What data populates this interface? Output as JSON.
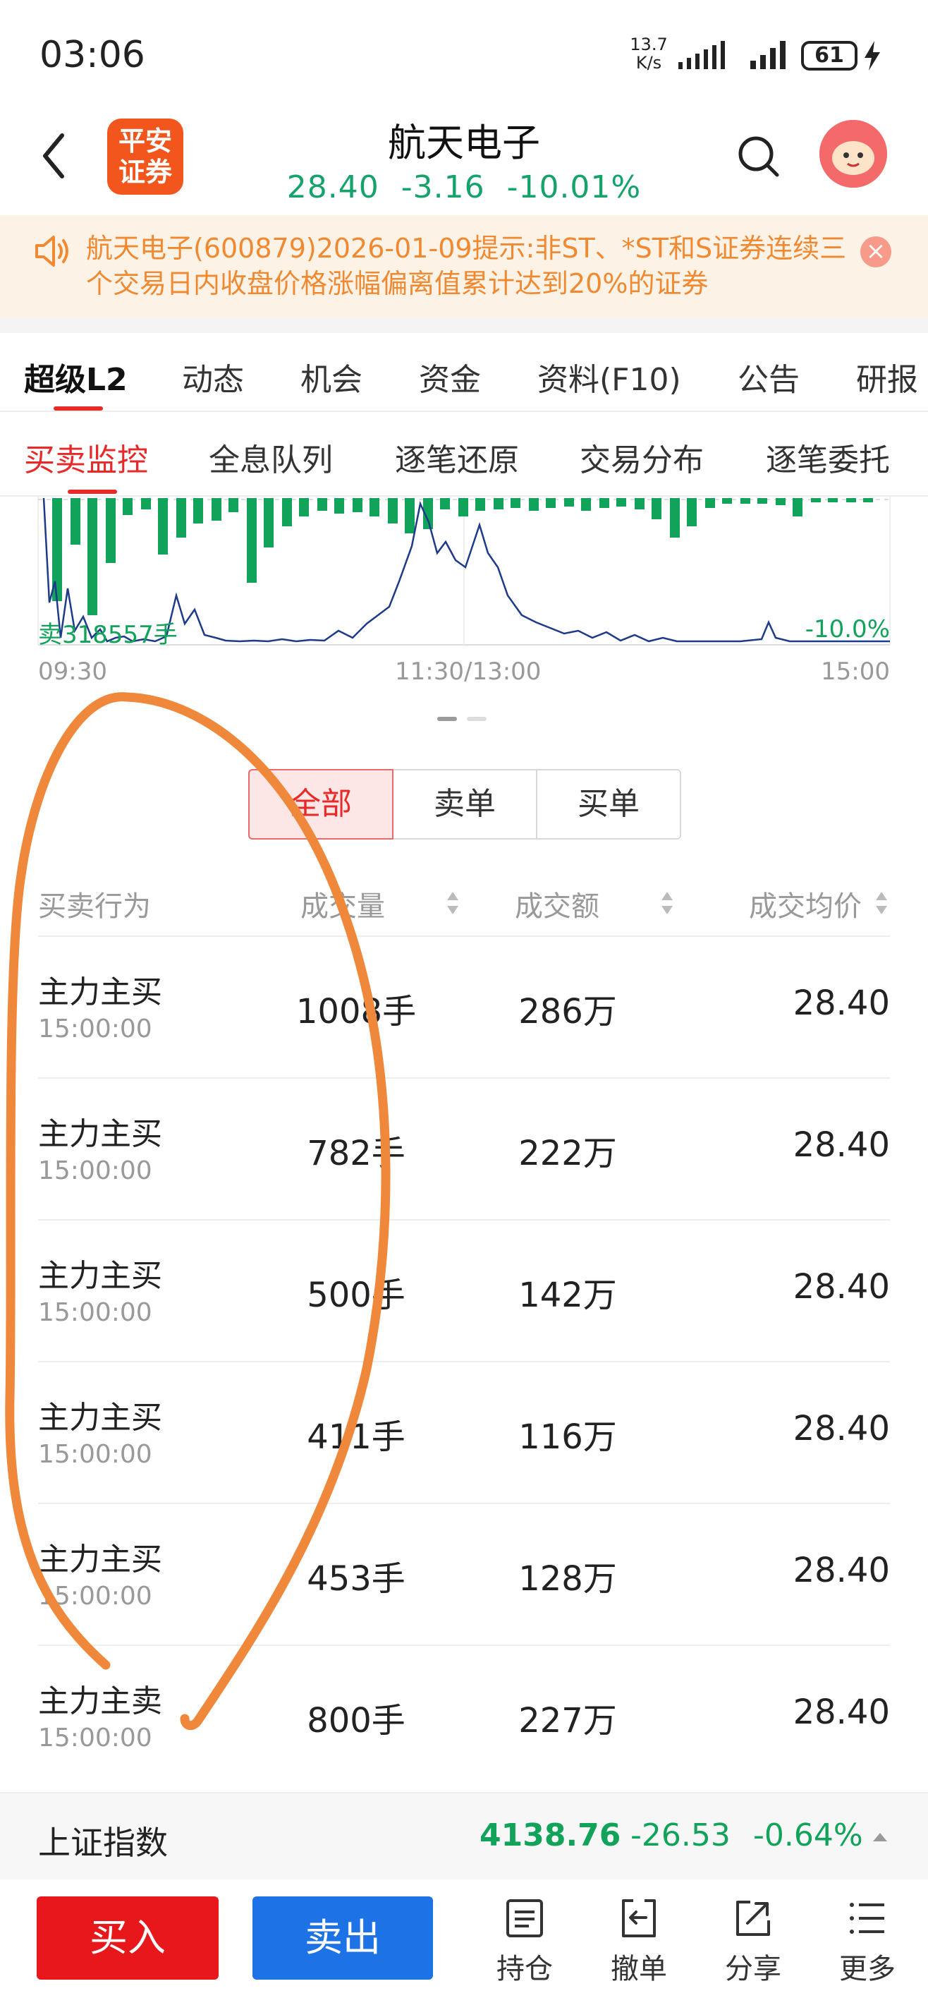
{
  "status_bar": {
    "time": "03:06",
    "net_speed_value": "13.7",
    "net_speed_unit": "K/s",
    "battery": "61"
  },
  "header": {
    "logo_line1": "平安",
    "logo_line2": "证券",
    "stock_name": "航天电子",
    "price": "28.40",
    "change": "-3.16",
    "change_pct": "-10.01%"
  },
  "notice": {
    "text": "航天电子(600879)2026-01-09提示:非ST、*ST和S证券连续三个交易日内收盘价格涨幅偏离值累计达到20%的证券"
  },
  "tabs_main": [
    "超级L2",
    "动态",
    "机会",
    "资金",
    "资料(F10)",
    "公告",
    "研报"
  ],
  "tabs_sub": [
    "买卖监控",
    "全息队列",
    "逐笔还原",
    "交易分布",
    "逐笔委托"
  ],
  "chart": {
    "sell_label": "卖318557手",
    "pct_label": "-10.0%",
    "time_start": "09:30",
    "time_mid": "11:30/13:00",
    "time_end": "15:00"
  },
  "filter": {
    "all": "全部",
    "sell": "卖单",
    "buy": "买单"
  },
  "table": {
    "headers": [
      "买卖行为",
      "成交量",
      "成交额",
      "成交均价"
    ],
    "rows": [
      {
        "action": "主力主买",
        "time": "15:00:00",
        "volume": "1008手",
        "amount": "286万",
        "price": "28.40"
      },
      {
        "action": "主力主买",
        "time": "15:00:00",
        "volume": "782手",
        "amount": "222万",
        "price": "28.40"
      },
      {
        "action": "主力主买",
        "time": "15:00:00",
        "volume": "500手",
        "amount": "142万",
        "price": "28.40"
      },
      {
        "action": "主力主买",
        "time": "15:00:00",
        "volume": "411手",
        "amount": "116万",
        "price": "28.40"
      },
      {
        "action": "主力主买",
        "time": "15:00:00",
        "volume": "453手",
        "amount": "128万",
        "price": "28.40"
      },
      {
        "action": "主力主卖",
        "time": "15:00:00",
        "volume": "800手",
        "amount": "227万",
        "price": "28.40"
      }
    ]
  },
  "index_bar": {
    "name": "上证指数",
    "value": "4138.76",
    "change": "-26.53",
    "change_pct": "-0.64%"
  },
  "bottom": {
    "buy": "买入",
    "sell": "卖出",
    "tools": [
      "持仓",
      "撤单",
      "分享",
      "更多"
    ]
  },
  "colors": {
    "up_red": "#e62a2a",
    "down_green": "#12a35b",
    "buy_btn": "#e8171b",
    "sell_btn": "#1d72e6",
    "annotation": "#f0883c"
  }
}
